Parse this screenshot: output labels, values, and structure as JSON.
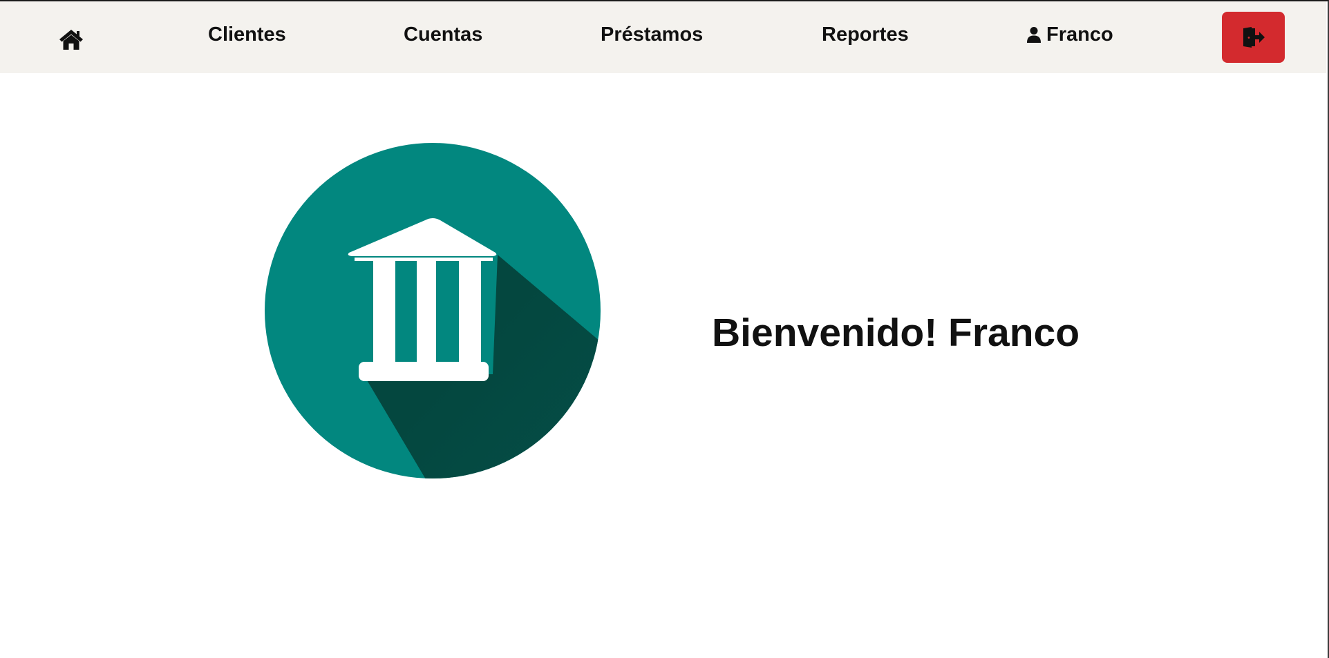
{
  "nav": {
    "home_icon": "home-icon",
    "links": {
      "clientes": "Clientes",
      "cuentas": "Cuentas",
      "prestamos": "Préstamos",
      "reportes": "Reportes"
    },
    "user": {
      "icon": "user-icon",
      "name": "Franco"
    },
    "logout": {
      "icon": "sign-out-icon",
      "color": "#d32a2e"
    }
  },
  "main": {
    "logo_icon": "bank-icon",
    "logo_color": "#02877f",
    "welcome_text": "Bienvenido! Franco"
  }
}
